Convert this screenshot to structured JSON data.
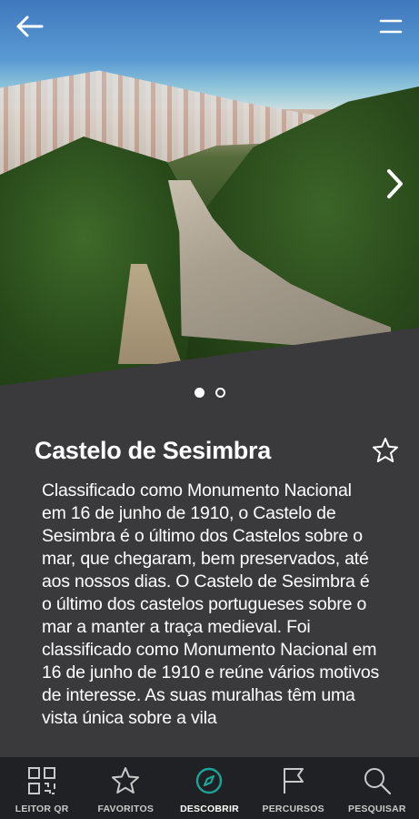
{
  "place": {
    "title": "Castelo de Sesimbra",
    "description": "Classificado como Monumento Nacional em 16 de junho de 1910, o Castelo de Sesimbra é o último dos Castelos sobre o mar, que chegaram, bem preservados, até aos nossos dias. O Castelo de Sesimbra é o último dos castelos portugueses sobre o mar a manter a traça medieval. Foi classificado como Monumento Nacional em 16 de junho de 1910 e reúne vários motivos de interesse. As suas muralhas têm uma vista única sobre a vila"
  },
  "gallery": {
    "current": 1,
    "total": 2
  },
  "tabs": [
    {
      "label": "LEITOR QR",
      "icon": "qr-icon"
    },
    {
      "label": "FAVORITOS",
      "icon": "star-icon"
    },
    {
      "label": "DESCOBRIR",
      "icon": "compass-icon",
      "active": true
    },
    {
      "label": "PERCURSOS",
      "icon": "flag-icon"
    },
    {
      "label": "PESQUISAR",
      "icon": "search-icon"
    }
  ],
  "colors": {
    "panel": "#3a3a3c",
    "tabbar": "#202124",
    "accent": "#1aa59a"
  }
}
